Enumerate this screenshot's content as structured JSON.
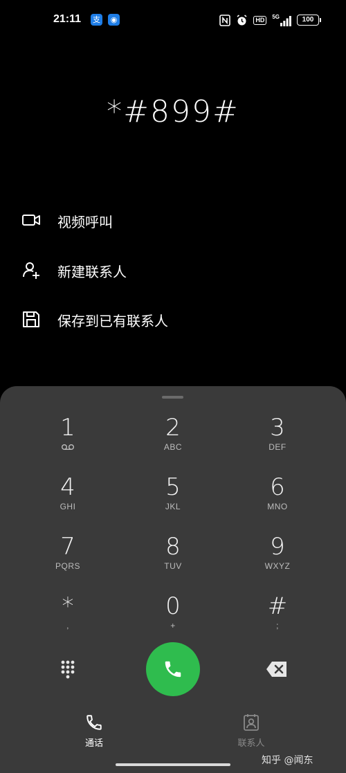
{
  "status_bar": {
    "time": "21:11",
    "app_badges": [
      "支",
      "◉"
    ],
    "icons": [
      "nfc-icon",
      "alarm-icon",
      "hd-icon",
      "5g-signal-icon",
      "battery-icon"
    ],
    "network": "5G",
    "hd": "HD",
    "battery": "100"
  },
  "dialer": {
    "number": "*#899#"
  },
  "actions": [
    {
      "label": "视频呼叫",
      "icon": "video-call-icon"
    },
    {
      "label": "新建联系人",
      "icon": "add-contact-icon"
    },
    {
      "label": "保存到已有联系人",
      "icon": "save-icon"
    }
  ],
  "keypad": [
    {
      "digit": "1",
      "letters": ""
    },
    {
      "digit": "2",
      "letters": "ABC"
    },
    {
      "digit": "3",
      "letters": "DEF"
    },
    {
      "digit": "4",
      "letters": "GHI"
    },
    {
      "digit": "5",
      "letters": "JKL"
    },
    {
      "digit": "6",
      "letters": "MNO"
    },
    {
      "digit": "7",
      "letters": "PQRS"
    },
    {
      "digit": "8",
      "letters": "TUV"
    },
    {
      "digit": "9",
      "letters": "WXYZ"
    },
    {
      "digit": "*",
      "letters": ","
    },
    {
      "digit": "0",
      "letters": "+"
    },
    {
      "digit": "#",
      "letters": ";"
    }
  ],
  "bottom_tabs": [
    {
      "label": "通话",
      "icon": "phone-icon",
      "active": true
    },
    {
      "label": "联系人",
      "icon": "contacts-icon",
      "active": false
    }
  ],
  "watermark": "知乎 @闻东",
  "colors": {
    "background": "#000000",
    "sheet": "#3a3a3a",
    "call_button": "#2fbc4e",
    "inactive_tab": "#8a8a8a"
  }
}
